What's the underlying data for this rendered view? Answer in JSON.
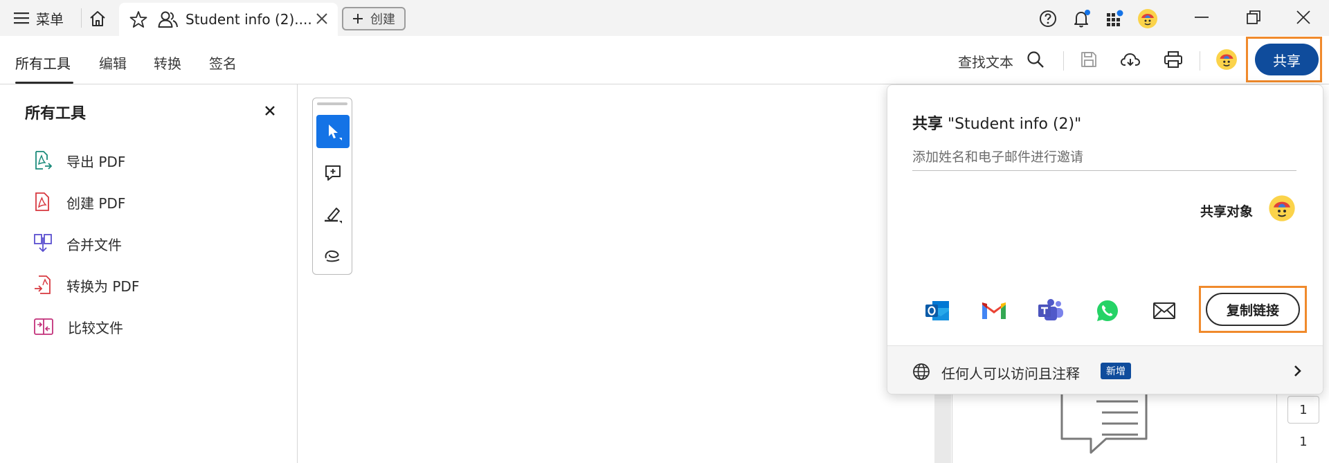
{
  "titlebar": {
    "menu_label": "菜单",
    "tab_title": "Student info (2)....",
    "create_label": "创建"
  },
  "toolbar": {
    "tabs": [
      "所有工具",
      "编辑",
      "转换",
      "签名"
    ],
    "find_text": "查找文本",
    "share_label": "共享"
  },
  "left_panel": {
    "title": "所有工具",
    "items": [
      {
        "label": "导出 PDF",
        "icon": "export-pdf-icon",
        "color": "#1a8a7a"
      },
      {
        "label": "创建 PDF",
        "icon": "create-pdf-icon",
        "color": "#d7373f"
      },
      {
        "label": "合并文件",
        "icon": "combine-files-icon",
        "color": "#5a4fcf"
      },
      {
        "label": "转换为 PDF",
        "icon": "convert-to-pdf-icon",
        "color": "#d7373f"
      },
      {
        "label": "比较文件",
        "icon": "compare-files-icon",
        "color": "#c2307a"
      }
    ]
  },
  "share_popover": {
    "title_prefix": "共享",
    "title_doc": " \"Student info (2)\"",
    "input_placeholder": "添加姓名和电子邮件进行邀请",
    "share_to_label": "共享对象",
    "apps": [
      "outlook-icon",
      "gmail-icon",
      "teams-icon",
      "whatsapp-icon",
      "mail-icon"
    ],
    "copy_link_label": "复制链接",
    "access_text": "任何人可以访问且注释",
    "new_badge": "新增"
  },
  "page_nav": {
    "current": "1",
    "total": "1"
  },
  "colors": {
    "accent_blue": "#0f4c9c",
    "highlight_orange": "#f08a2c",
    "tool_active": "#1473e6"
  }
}
